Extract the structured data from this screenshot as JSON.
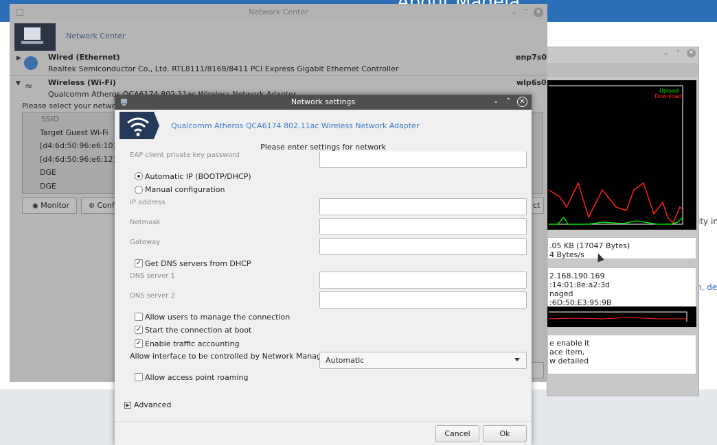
{
  "background_window": {
    "title": "About Mageia",
    "fragment_period": ".",
    "fragment_text": "ity in",
    "fragment_link": "n, de"
  },
  "monitor": {
    "legend_upload": "Upload",
    "legend_download": "Download",
    "traffic_line1": ".05 KB (17047 Bytes)",
    "traffic_line2": "4 Bytes/s",
    "info_ip": "2.168.190.169",
    "info_ipv6": ":14:01:8e:a2:3d",
    "info_managed": "naged",
    "info_mac": ":6D:50:E3:95:9B",
    "hint_line1": "e enable it",
    "hint_line2": "ace item,",
    "hint_line3": "w detailed",
    "colors": {
      "upload": "#00e000",
      "download": "#ff2020"
    }
  },
  "network_center": {
    "title": "Network Center",
    "header": "Network Center",
    "wired": {
      "name": "Wired (Ethernet)",
      "interface": "enp7s0",
      "description": "Realtek Semiconductor Co., Ltd. RTL8111/8168/8411 PCI Express Gigabit Ethernet Controller"
    },
    "wireless": {
      "name": "Wireless (Wi-Fi)",
      "interface": "wlp6s0",
      "description": "Qualcomm Atheros QCA6174 802.11ac Wireless Network Adapter"
    },
    "select_prompt": "Please select your network:",
    "ssid_header": "SSID",
    "networks": [
      "Target Guest Wi-Fi",
      "[d4:6d:50:96:e6:10]",
      "[d4:6d:50:96:e6:12]",
      "DGE",
      "DGE"
    ],
    "monitor_button": "Monitor",
    "configure_button": "Confi",
    "connect_button_fragment": "ct"
  },
  "dialog": {
    "title": "Network settings",
    "adapter": "Qualcomm Atheros QCA6174 802.11ac Wireless Network Adapter",
    "subtitle": "Please enter settings for network",
    "eap_label": "EAP client private key password",
    "eap_value": "",
    "radio_auto": "Automatic IP (BOOTP/DHCP)",
    "radio_manual": "Manual configuration",
    "ip_label": "IP address",
    "ip_value": "",
    "netmask_label": "Netmask",
    "netmask_value": "",
    "gateway_label": "Gateway",
    "gateway_value": "",
    "dns_dhcp_label": "Get DNS servers from DHCP",
    "dns1_label": "DNS server 1",
    "dns1_value": "",
    "dns2_label": "DNS server 2",
    "dns2_value": "",
    "allow_users_label": "Allow users to manage the connection",
    "start_boot_label": "Start the connection at boot",
    "traffic_label": "Enable traffic accounting",
    "nm_label": "Allow interface to be controlled by Network Manager",
    "nm_value": "Automatic",
    "roaming_label": "Allow access point roaming",
    "advanced_label": "Advanced",
    "cancel_label": "Cancel",
    "ok_label": "Ok",
    "state": {
      "auto_ip": true,
      "manual": false,
      "dns_dhcp": true,
      "allow_users": false,
      "start_boot": true,
      "traffic": true,
      "roaming": false
    }
  }
}
